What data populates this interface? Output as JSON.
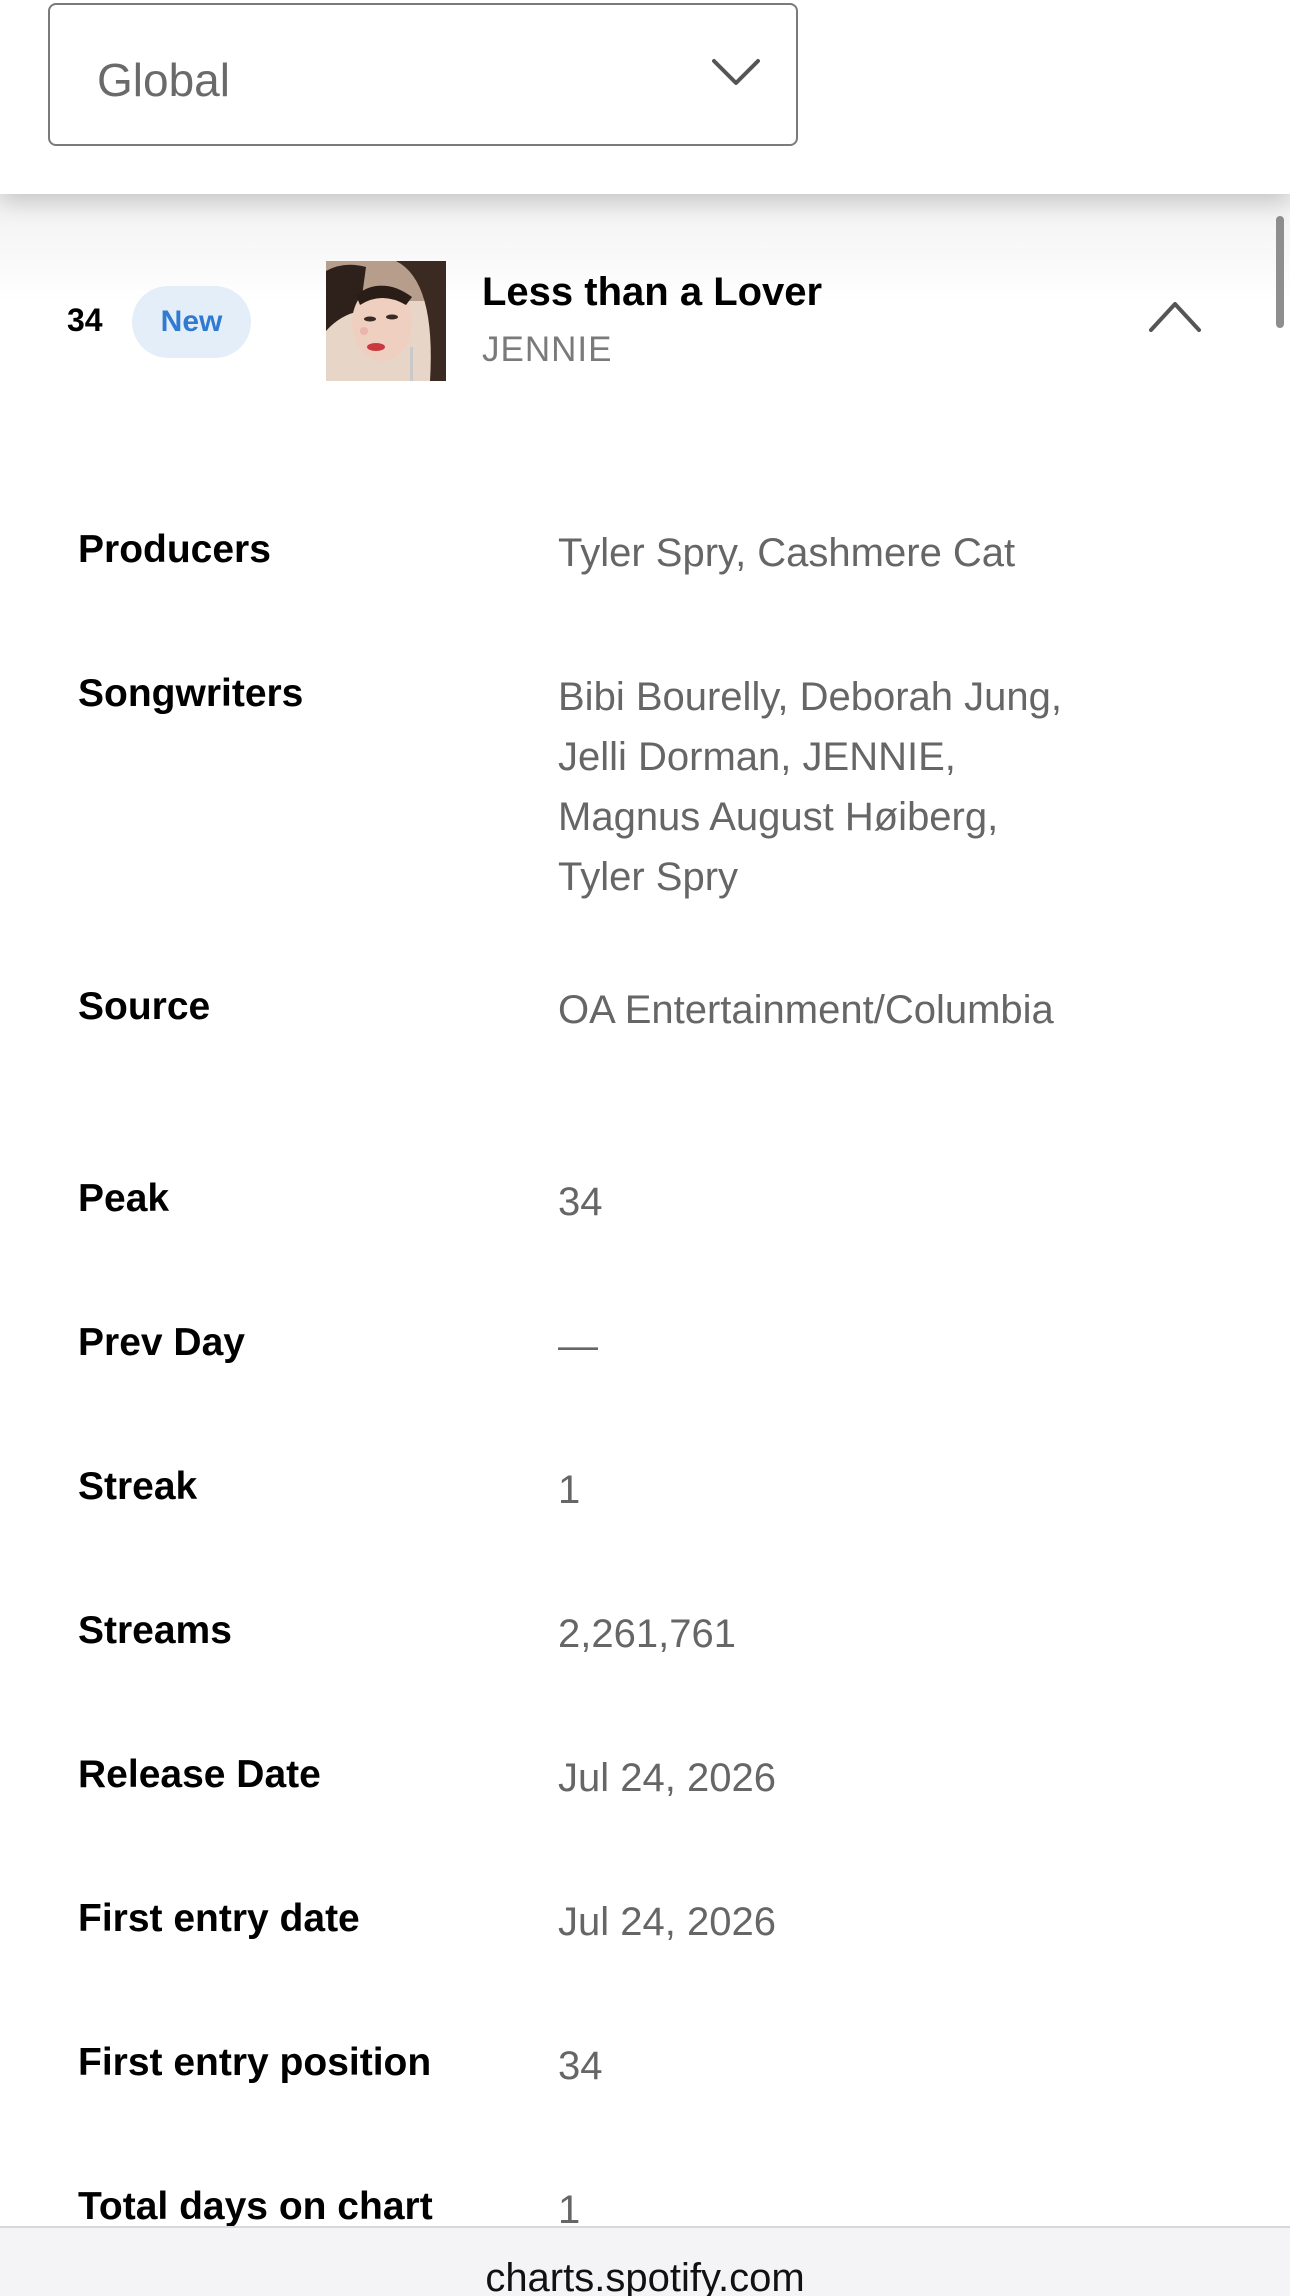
{
  "region_selector": {
    "value": "Global"
  },
  "track": {
    "rank": "34",
    "badge": "New",
    "title": "Less than a Lover",
    "artist": "JENNIE"
  },
  "details": [
    {
      "label": "Producers",
      "value": "Tyler Spry, Cashmere Cat"
    },
    {
      "label": "Songwriters",
      "value": "Bibi Bourelly, Deborah Jung, Jelli Dorman, JENNIE, Magnus August Høiberg, Tyler Spry"
    },
    {
      "label": "Source",
      "value": "OA Entertainment/Columbia"
    },
    {
      "label": "Peak",
      "value": "34"
    },
    {
      "label": "Prev Day",
      "value": "—"
    },
    {
      "label": "Streak",
      "value": "1"
    },
    {
      "label": "Streams",
      "value": "2,261,761"
    },
    {
      "label": "Release Date",
      "value": "Jul 24, 2026"
    },
    {
      "label": "First entry date",
      "value": "Jul 24, 2026"
    },
    {
      "label": "First entry position",
      "value": "34"
    },
    {
      "label": "Total days on chart",
      "value": "1"
    }
  ],
  "browser": {
    "url": "charts.spotify.com"
  },
  "colors": {
    "badge_bg": "#e4eef8",
    "badge_text": "#2f7bd1",
    "value_text": "#666666"
  },
  "icons": {
    "dropdown": "chevron-down-icon",
    "collapse": "chevron-up-icon"
  }
}
